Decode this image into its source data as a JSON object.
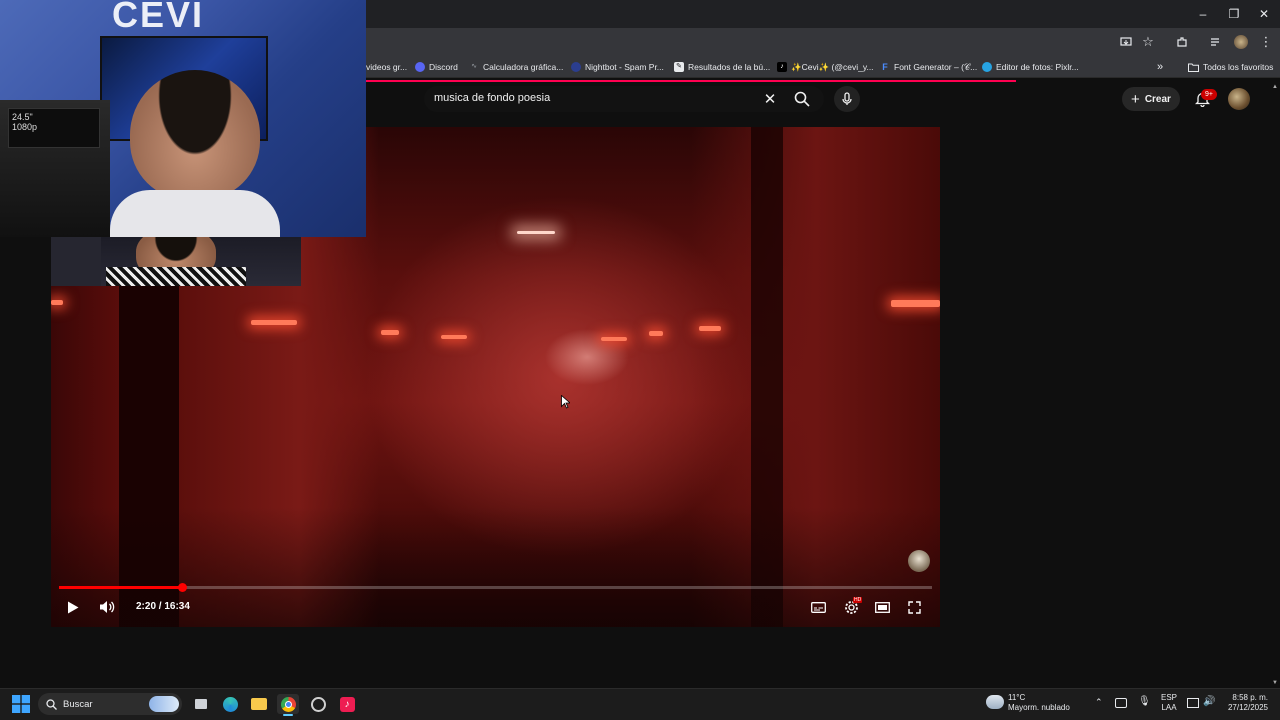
{
  "window": {
    "minimize_label": "–",
    "restore_label": "❐",
    "close_label": "✕"
  },
  "bookmarks": [
    {
      "label": "videos gr...",
      "icon": "partial-icon",
      "color": "#303134"
    },
    {
      "label": "Discord",
      "icon": "discord-icon",
      "color": "#5865f2"
    },
    {
      "label": "Calculadora gráfica...",
      "icon": "desmos-icon",
      "color": "#3a3a3a"
    },
    {
      "label": "Nightbot - Spam Pr...",
      "icon": "nightbot-icon",
      "color": "#3b4fa8"
    },
    {
      "label": "Resultados de la bú...",
      "icon": "search-result-icon",
      "color": "#5f6368"
    },
    {
      "label": "✨Cevi✨ (@cevi_y...",
      "icon": "tiktok-icon",
      "color": "#000000"
    },
    {
      "label": "Font Generator – (𝒞...",
      "icon": "font-f-icon",
      "color": "#1a73e8"
    },
    {
      "label": "Editor de fotos: Pixlr...",
      "icon": "pixlr-icon",
      "color": "#27a4e3"
    }
  ],
  "bookmarks_more": "»",
  "all_favorites": "Todos los favoritos",
  "search": {
    "query": "musica de fondo poesia"
  },
  "header": {
    "create_label": "Crear",
    "notif_count": "9+"
  },
  "player": {
    "current_time": "2:20",
    "duration": "16:34",
    "timecode": "2:20 / 16:34",
    "progress": 0.1408,
    "settings_badge": "HD"
  },
  "webcam": {
    "overlay_text": "CEVI",
    "monitor_text_1": "24.5\"",
    "monitor_text_2": "1080p"
  },
  "taskbar": {
    "search_label": "Buscar",
    "weather_temp": "11°C",
    "weather_desc": "Mayorm. nublado",
    "lang_1": "ESP",
    "lang_2": "LAA",
    "time": "8:58 p. m.",
    "date": "27/12/2025"
  },
  "colors": {
    "accent_red": "#ff0000",
    "yt_bg": "#0f0f0f",
    "chrome_dark": "#35363a",
    "loadbar": "#ff0050"
  }
}
